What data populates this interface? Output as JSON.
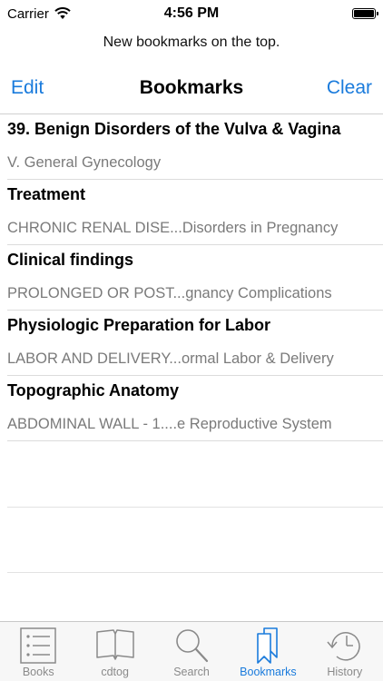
{
  "status_bar": {
    "carrier": "Carrier",
    "time": "4:56 PM",
    "battery_level": 1.0
  },
  "banner": {
    "text": "New bookmarks on the top."
  },
  "nav": {
    "edit_label": "Edit",
    "title": "Bookmarks",
    "clear_label": "Clear",
    "accent_color": "#1a7bdc"
  },
  "bookmarks": [
    {
      "title": "39. Benign Disorders of the Vulva & Vagina",
      "subtitle": "V. General Gynecology"
    },
    {
      "title": "Treatment",
      "subtitle": "CHRONIC RENAL DISE...Disorders in Pregnancy"
    },
    {
      "title": "Clinical findings",
      "subtitle": "PROLONGED OR POST...gnancy Complications"
    },
    {
      "title": "Physiologic Preparation for Labor",
      "subtitle": "LABOR AND DELIVERY...ormal Labor & Delivery"
    },
    {
      "title": "Topographic Anatomy",
      "subtitle": "ABDOMINAL WALL - 1....e Reproductive System"
    }
  ],
  "tabs": [
    {
      "label": "Books",
      "icon": "list-icon",
      "active": false
    },
    {
      "label": "cdtog",
      "icon": "open-book-icon",
      "active": false
    },
    {
      "label": "Search",
      "icon": "magnifier-icon",
      "active": false
    },
    {
      "label": "Bookmarks",
      "icon": "bookmarks-icon",
      "active": true
    },
    {
      "label": "History",
      "icon": "clock-history-icon",
      "active": false
    }
  ]
}
